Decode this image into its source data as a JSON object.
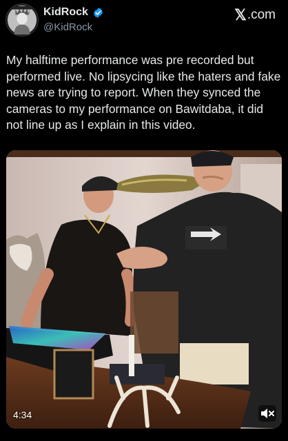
{
  "author": {
    "display_name": "KidRock",
    "handle": "@KidRock",
    "verified": true,
    "avatar_icon": "statue-of-liberty-avatar"
  },
  "brand": {
    "label": ".com",
    "icon": "x-logo-icon"
  },
  "tweet": {
    "text": "My halftime performance was pre recorded but performed live. No lipsycing like the haters and fake news are trying to report. When they synced the cameras to my performance on Bawitdaba, it did not line up as I explain in this video."
  },
  "video": {
    "duration": "4:34",
    "muted": true
  },
  "colors": {
    "background": "#000000",
    "text": "#e7e9ea",
    "secondary_text": "#8b98a5",
    "verified_blue": "#1d9bf0"
  }
}
